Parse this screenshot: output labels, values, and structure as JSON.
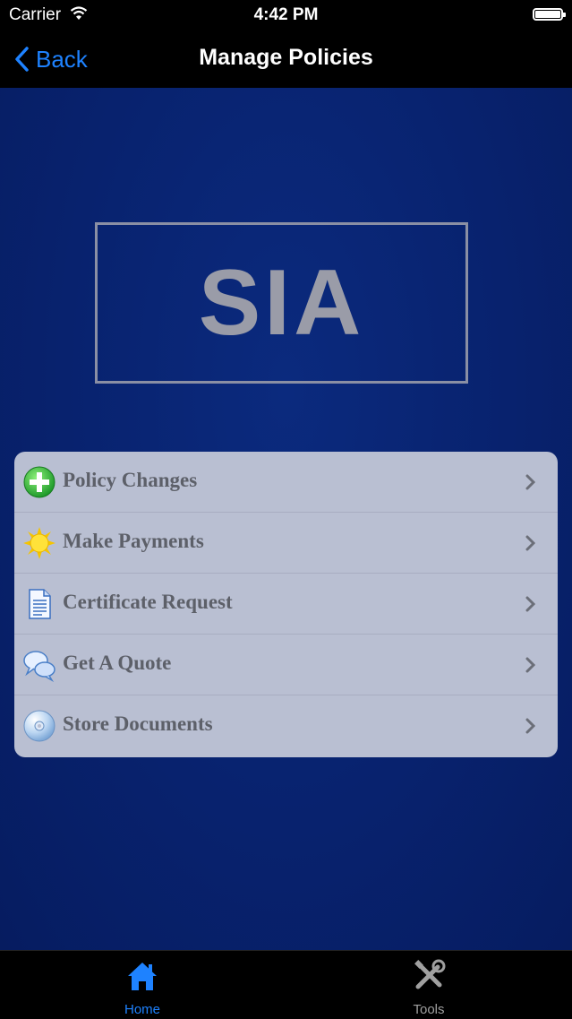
{
  "status_bar": {
    "carrier": "Carrier",
    "time": "4:42 PM"
  },
  "nav": {
    "back_label": "Back",
    "title": "Manage Policies"
  },
  "logo": {
    "text": "SIA"
  },
  "menu": {
    "items": [
      {
        "label": "Policy Changes",
        "icon": "plus-circle-icon"
      },
      {
        "label": "Make Payments",
        "icon": "sun-icon"
      },
      {
        "label": "Certificate Request",
        "icon": "document-icon"
      },
      {
        "label": "Get A Quote",
        "icon": "chat-bubbles-icon"
      },
      {
        "label": "Store Documents",
        "icon": "disc-icon"
      }
    ]
  },
  "tabs": [
    {
      "label": "Home",
      "icon": "home-icon",
      "selected": true
    },
    {
      "label": "Tools",
      "icon": "tools-icon",
      "selected": false
    }
  ],
  "colors": {
    "accent": "#1e82ff",
    "background": "#08226e",
    "menu_bg": "#b9bfd2"
  }
}
